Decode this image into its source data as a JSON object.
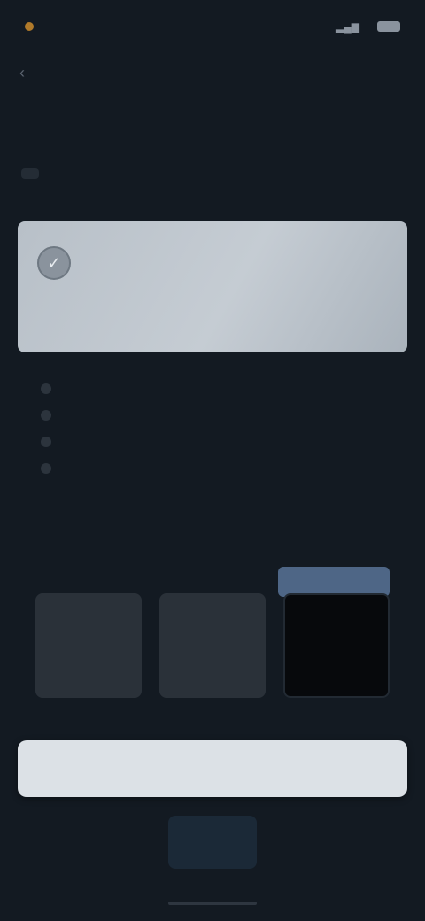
{
  "status": {
    "app_label": "",
    "time": "",
    "signal": ""
  },
  "nav": {
    "url": "",
    "back_icon": "back-arrow-icon"
  },
  "page": {
    "title": ""
  },
  "tabs": [
    {
      "label": ""
    },
    {
      "label": ""
    }
  ],
  "hero": {
    "icon": "shield-icon",
    "title": "",
    "subtitle": ""
  },
  "features": [
    {
      "label": ""
    },
    {
      "label": ""
    },
    {
      "label": ""
    },
    {
      "label": ""
    }
  ],
  "plans": {
    "badge": "",
    "items": [
      {
        "name": "",
        "price": "",
        "period": ""
      },
      {
        "name": "",
        "price": "",
        "period": ""
      },
      {
        "name": "",
        "price": "",
        "period": ""
      }
    ]
  },
  "cta": {
    "label": ""
  },
  "bottom_nav": [
    {
      "label": ""
    },
    {
      "label": ""
    },
    {
      "label": ""
    }
  ],
  "colors": {
    "background": "#131a22",
    "hero": "#c5ccd3",
    "badge": "#4e6686",
    "cta": "#dce1e6"
  }
}
